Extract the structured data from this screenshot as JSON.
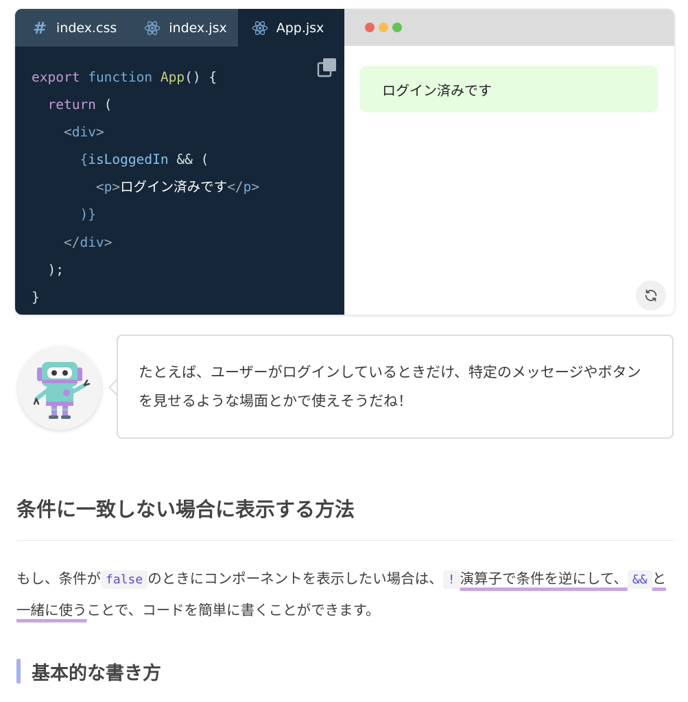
{
  "editor": {
    "tabs": [
      {
        "label": "index.css",
        "icon": "hash-icon",
        "active": false
      },
      {
        "label": "index.jsx",
        "icon": "react-icon",
        "active": false
      },
      {
        "label": "App.jsx",
        "icon": "react-icon",
        "active": true
      }
    ],
    "code": {
      "l1_kw1": "export",
      "l1_kw2": "function",
      "l1_name": "App",
      "l1_rest": "() {",
      "l2_kw": "return",
      "l2_rest": " (",
      "l3_tag": "div",
      "l4_var": "isLoggedIn",
      "l4_rest": " && (",
      "l5_tag": "p",
      "l5_text": "ログイン済みです",
      "l6": ")}",
      "l7_tag": "div",
      "l8": ");",
      "l9": "}"
    }
  },
  "preview": {
    "message": "ログイン済みです",
    "dot_colors": [
      "#ed6a5e",
      "#f5bf4f",
      "#61c554"
    ]
  },
  "chat": {
    "text": "たとえば、ユーザーがログインしているときだけ、特定のメッセージやボタンを見せるような場面とかで使えそうだね！"
  },
  "article": {
    "heading": "条件に一致しない場合に表示する方法",
    "para": {
      "p1": "もし、条件が",
      "code1": "false",
      "p2": "のときにコンポーネントを表示したい場合は、",
      "code2": "!",
      "mark1": "演算子で条件を逆に",
      "mark2": "して、",
      "code3": "&&",
      "mark3": "と一緒に使う",
      "p3": "ことで、コードを簡単に書くことができます。"
    },
    "subheading": "基本的な書き方"
  }
}
